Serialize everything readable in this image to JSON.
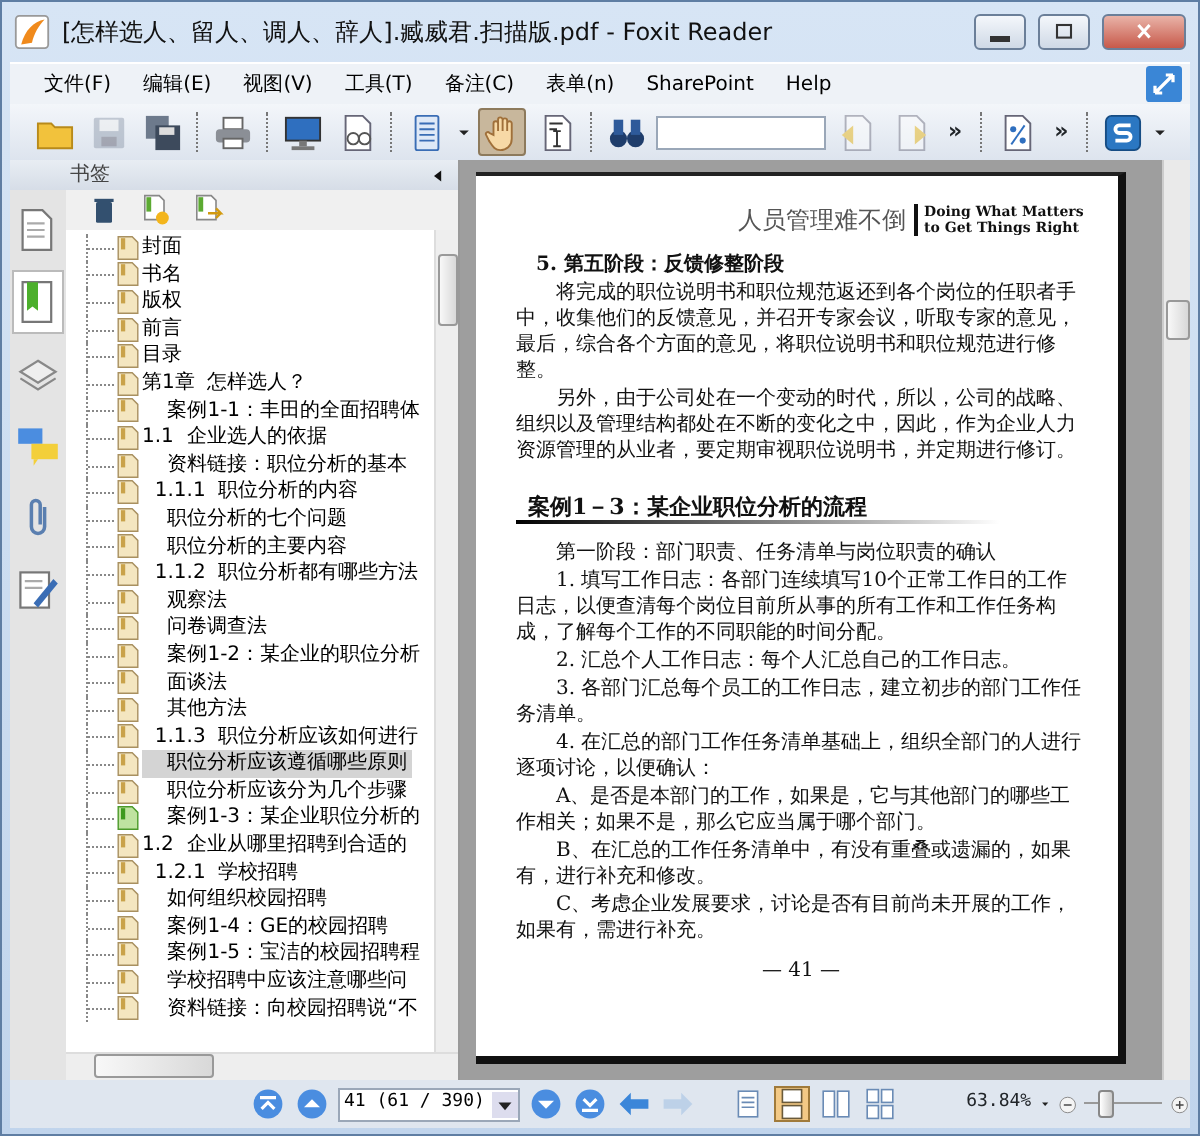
{
  "window": {
    "title": "[怎样选人、留人、调人、辞人].臧威君.扫描版.pdf - Foxit Reader"
  },
  "menu": [
    "文件(F)",
    "编辑(E)",
    "视图(V)",
    "工具(T)",
    "备注(C)",
    "表单(n)",
    "SharePoint",
    "Help"
  ],
  "toolbar": [
    {
      "kind": "folder",
      "selected": false,
      "disabled": false
    },
    {
      "kind": "disk",
      "selected": false,
      "disabled": true
    },
    {
      "kind": "disks",
      "selected": false,
      "disabled": false
    },
    {
      "kind": "sep"
    },
    {
      "kind": "printer",
      "selected": false,
      "disabled": false
    },
    {
      "kind": "sep"
    },
    {
      "kind": "monitor",
      "selected": false,
      "disabled": false
    },
    {
      "kind": "glasses",
      "selected": false,
      "disabled": false
    },
    {
      "kind": "sep"
    },
    {
      "kind": "page",
      "selected": false,
      "disabled": false
    },
    {
      "kind": "caret"
    },
    {
      "kind": "hand",
      "selected": true,
      "disabled": false
    },
    {
      "kind": "textsel",
      "selected": false,
      "disabled": false
    },
    {
      "kind": "sep"
    },
    {
      "kind": "binoculars",
      "selected": false,
      "disabled": false
    },
    {
      "kind": "field"
    },
    {
      "kind": "findprev",
      "selected": false,
      "disabled": true
    },
    {
      "kind": "findnext",
      "selected": false,
      "disabled": true
    },
    {
      "kind": "more",
      "text": "»"
    },
    {
      "kind": "sep"
    },
    {
      "kind": "percent",
      "selected": false,
      "disabled": false
    },
    {
      "kind": "more",
      "text": "»"
    },
    {
      "kind": "sep"
    },
    {
      "kind": "logo",
      "selected": false,
      "disabled": false
    },
    {
      "kind": "caret"
    }
  ],
  "side_tabs": [
    {
      "kind": "pages",
      "selected": false
    },
    {
      "kind": "bookmarks",
      "selected": true
    },
    {
      "kind": "layers",
      "selected": false
    },
    {
      "kind": "comments",
      "selected": false
    },
    {
      "kind": "attachments",
      "selected": false
    },
    {
      "kind": "signatures",
      "selected": false
    }
  ],
  "bookmarks_panel": {
    "title": "书签",
    "tools": [
      {
        "kind": "trash"
      },
      {
        "kind": "add"
      },
      {
        "kind": "addsub"
      }
    ],
    "items": [
      {
        "text": "封面",
        "selected": false,
        "current": false
      },
      {
        "text": "书名",
        "selected": false,
        "current": false
      },
      {
        "text": "版权",
        "selected": false,
        "current": false
      },
      {
        "text": "前言",
        "selected": false,
        "current": false
      },
      {
        "text": "目录",
        "selected": false,
        "current": false
      },
      {
        "text": "第1章  怎样选人？",
        "selected": false,
        "current": false
      },
      {
        "text": "    案例1-1：丰田的全面招聘体",
        "selected": false,
        "current": false
      },
      {
        "text": "1.1  企业选人的依据",
        "selected": false,
        "current": false
      },
      {
        "text": "    资料链接：职位分析的基本",
        "selected": false,
        "current": false
      },
      {
        "text": "  1.1.1  职位分析的内容",
        "selected": false,
        "current": false
      },
      {
        "text": "    职位分析的七个问题",
        "selected": false,
        "current": false
      },
      {
        "text": "    职位分析的主要内容",
        "selected": false,
        "current": false
      },
      {
        "text": "  1.1.2  职位分析都有哪些方法",
        "selected": false,
        "current": false
      },
      {
        "text": "    观察法",
        "selected": false,
        "current": false
      },
      {
        "text": "    问卷调查法",
        "selected": false,
        "current": false
      },
      {
        "text": "    案例1-2：某企业的职位分析",
        "selected": false,
        "current": false
      },
      {
        "text": "    面谈法",
        "selected": false,
        "current": false
      },
      {
        "text": "    其他方法",
        "selected": false,
        "current": false
      },
      {
        "text": "  1.1.3  职位分析应该如何进行",
        "selected": false,
        "current": false
      },
      {
        "text": "    职位分析应该遵循哪些原则",
        "selected": true,
        "current": false
      },
      {
        "text": "    职位分析应该分为几个步骤",
        "selected": false,
        "current": false
      },
      {
        "text": "    案例1-3：某企业职位分析的",
        "selected": false,
        "current": true
      },
      {
        "text": "1.2  企业从哪里招聘到合适的",
        "selected": false,
        "current": false
      },
      {
        "text": "  1.2.1  学校招聘",
        "selected": false,
        "current": false
      },
      {
        "text": "    如何组织校园招聘",
        "selected": false,
        "current": false
      },
      {
        "text": "    案例1-4：GE的校园招聘",
        "selected": false,
        "current": false
      },
      {
        "text": "    案例1-5：宝洁的校园招聘程",
        "selected": false,
        "current": false
      },
      {
        "text": "    学校招聘中应该注意哪些问",
        "selected": false,
        "current": false
      },
      {
        "text": "    资料链接：向校园招聘说“不",
        "selected": false,
        "current": false
      }
    ]
  },
  "document_page": {
    "header_title": "人员管理难不倒",
    "header_subtitle": "Doing What Matters to Get Things Right",
    "blocks": [
      {
        "kind": "heading",
        "text": "5. 第五阶段：反馈修整阶段"
      },
      {
        "kind": "para",
        "text": "将完成的职位说明书和职位规范返还到各个岗位的任职者手中，收集他们的反馈意见，并召开专家会议，听取专家的意见，最后，综合各个方面的意见，将职位说明书和职位规范进行修整。"
      },
      {
        "kind": "para",
        "text": "另外，由于公司处在一个变动的时代，所以，公司的战略、组织以及管理结构都处在不断的变化之中，因此，作为企业人力资源管理的从业者，要定期审视职位说明书，并定期进行修订。"
      },
      {
        "kind": "case",
        "text": "案例1－3：某企业职位分析的流程"
      },
      {
        "kind": "para",
        "text": "第一阶段：部门职责、任务清单与岗位职责的确认"
      },
      {
        "kind": "para",
        "text": "1. 填写工作日志：各部门连续填写10个正常工作日的工作日志，以便查清每个岗位目前所从事的所有工作和工作任务构成，了解每个工作的不同职能的时间分配。"
      },
      {
        "kind": "para",
        "text": "2. 汇总个人工作日志：每个人汇总自己的工作日志。"
      },
      {
        "kind": "para",
        "text": "3. 各部门汇总每个员工的工作日志，建立初步的部门工作任务清单。"
      },
      {
        "kind": "para",
        "text": "4. 在汇总的部门工作任务清单基础上，组织全部门的人进行逐项讨论，以便确认："
      },
      {
        "kind": "para",
        "text": "A、是否是本部门的工作，如果是，它与其他部门的哪些工作相关；如果不是，那么它应当属于哪个部门。"
      },
      {
        "kind": "para",
        "text": "B、在汇总的工作任务清单中，有没有重叠或遗漏的，如果有，进行补充和修改。"
      },
      {
        "kind": "para",
        "text": "C、考虑企业发展要求，讨论是否有目前尚未开展的工作，如果有，需进行补充。"
      },
      {
        "kind": "pageno",
        "text": "— 41 —"
      }
    ]
  },
  "status_bar": {
    "nav_before": [
      {
        "kind": "first",
        "disabled": false
      },
      {
        "kind": "prev",
        "disabled": false
      }
    ],
    "page_field": {
      "value": "41 (61 / 390)"
    },
    "nav_after": [
      {
        "kind": "next",
        "disabled": false
      },
      {
        "kind": "last",
        "disabled": false
      },
      {
        "kind": "back",
        "disabled": false
      },
      {
        "kind": "forward",
        "disabled": true
      }
    ],
    "layouts": [
      {
        "kind": "single",
        "selected": false
      },
      {
        "kind": "continuous",
        "selected": true
      },
      {
        "kind": "facing",
        "selected": false
      },
      {
        "kind": "contfacing",
        "selected": false
      }
    ],
    "zoom": {
      "value": "63.84%",
      "level": 0.28
    }
  }
}
